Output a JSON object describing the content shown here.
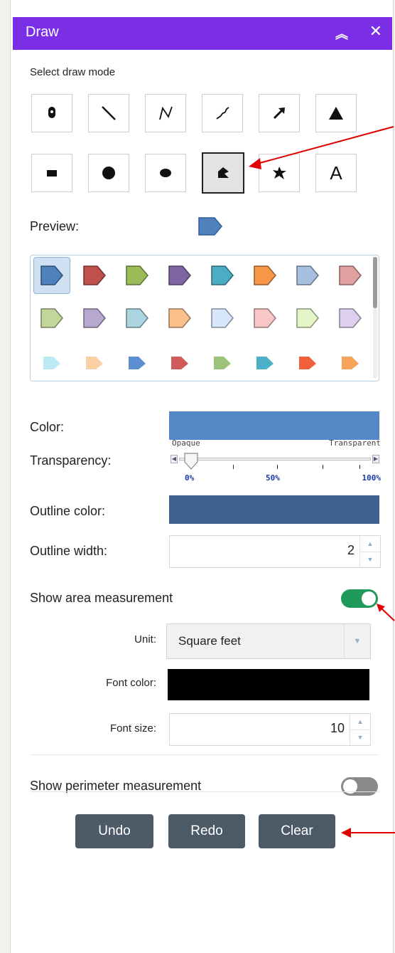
{
  "panel": {
    "title": "Draw",
    "collapse_icon": "double-chevron-up-icon",
    "close_icon": "close-icon",
    "accent_color": "#7a2ee6"
  },
  "draw_mode": {
    "label": "Select draw mode",
    "modes_row1": [
      "point",
      "line",
      "polyline",
      "freehand-polyline",
      "arrow",
      "triangle"
    ],
    "modes_row2": [
      "rectangle",
      "circle",
      "ellipse",
      "polygon",
      "freehand-polygon",
      "text"
    ],
    "text_mode_label": "A",
    "selected": "polygon"
  },
  "preview": {
    "label": "Preview:"
  },
  "symbols": {
    "rows": [
      [
        "#4f81bd",
        "#c0504d",
        "#9bbb59",
        "#8064a2",
        "#4bacc6",
        "#f79646",
        "#a7c0e0",
        "#e0a0a0"
      ],
      [
        "#c4d79b",
        "#b7a8cf",
        "#a9d4e0",
        "#fbc08c",
        "#d6e6fb",
        "#f7c6c6",
        "#e4f5c8",
        "#dcd0ee"
      ],
      [
        "#bde9f5",
        "#fcd0a7",
        "#5b8fd0",
        "#d05b5b",
        "#9bc47a",
        "#4bb1c6",
        "#f0603a",
        "#f6a45a"
      ]
    ],
    "selected_index": 0
  },
  "color": {
    "label": "Color:",
    "value": "#5588c6"
  },
  "transparency": {
    "label": "Transparency:",
    "left_label": "Opaque",
    "right_label": "Transparent",
    "tick_labels": [
      "0%",
      "50%",
      "100%"
    ],
    "value": 0
  },
  "outline_color": {
    "label": "Outline color:",
    "value": "#3f6192"
  },
  "outline_width": {
    "label": "Outline width:",
    "value": "2"
  },
  "area_measurement": {
    "label": "Show area measurement",
    "enabled": true,
    "unit_label": "Unit:",
    "unit_value": "Square feet",
    "font_color_label": "Font color:",
    "font_color": "#000000",
    "font_size_label": "Font size:",
    "font_size": "10"
  },
  "perimeter_measurement": {
    "label": "Show perimeter measurement",
    "enabled": false
  },
  "actions": {
    "undo": "Undo",
    "redo": "Redo",
    "clear": "Clear"
  },
  "colors": {
    "toggle_on": "#1f9a5a",
    "toggle_off": "#8a8a8a",
    "annotation_arrow": "#e00000",
    "button_bg": "#4c5a68"
  }
}
